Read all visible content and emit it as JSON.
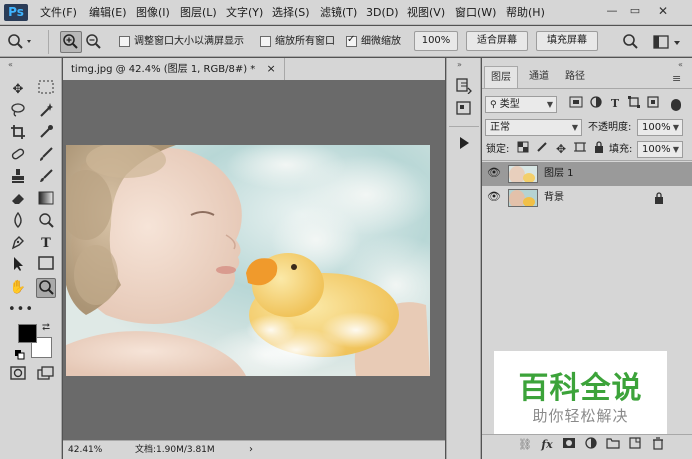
{
  "app": {
    "logo": "Ps"
  },
  "menu": {
    "items": [
      "文件(F)",
      "编辑(E)",
      "图像(I)",
      "图层(L)",
      "文字(Y)",
      "选择(S)",
      "滤镜(T)",
      "3D(D)",
      "视图(V)",
      "窗口(W)",
      "帮助(H)"
    ]
  },
  "window_controls": {
    "minimize": "—",
    "restore": "▭",
    "close": "✕"
  },
  "options": {
    "resize_windows_label": "调整窗口大小以满屏显示",
    "resize_windows_checked": false,
    "zoom_all_label": "缩放所有窗口",
    "zoom_all_checked": false,
    "scrubby_zoom_label": "细微缩放",
    "scrubby_zoom_checked": true,
    "percent_button": "100%",
    "fit_screen_button": "适合屏幕",
    "fill_screen_button": "填充屏幕"
  },
  "document": {
    "tab_title": "timg.jpg @ 42.4% (图层 1, RGB/8#) *",
    "tab_close": "×",
    "zoom_readout": "42.41%",
    "doc_size": "文档:1.90M/3.81M"
  },
  "layers_panel": {
    "tabs": [
      "图层",
      "通道",
      "路径"
    ],
    "filter_kind": "类型",
    "blend_mode": "正常",
    "opacity_label": "不透明度:",
    "opacity_value": "100%",
    "lock_label": "锁定:",
    "fill_label": "填充:",
    "fill_value": "100%",
    "layers": [
      {
        "name": "图层 1",
        "visible": true,
        "selected": true,
        "locked": false
      },
      {
        "name": "背景",
        "visible": true,
        "selected": false,
        "locked": true
      }
    ]
  },
  "watermark": {
    "title": "百科全说",
    "subtitle": "助你轻松解决"
  },
  "colors": {
    "chrome": "#d6d6d6",
    "canvas_bg": "#6a6a6a",
    "selected_layer": "#9a9a9a",
    "watermark_green": "#3ca33a"
  }
}
